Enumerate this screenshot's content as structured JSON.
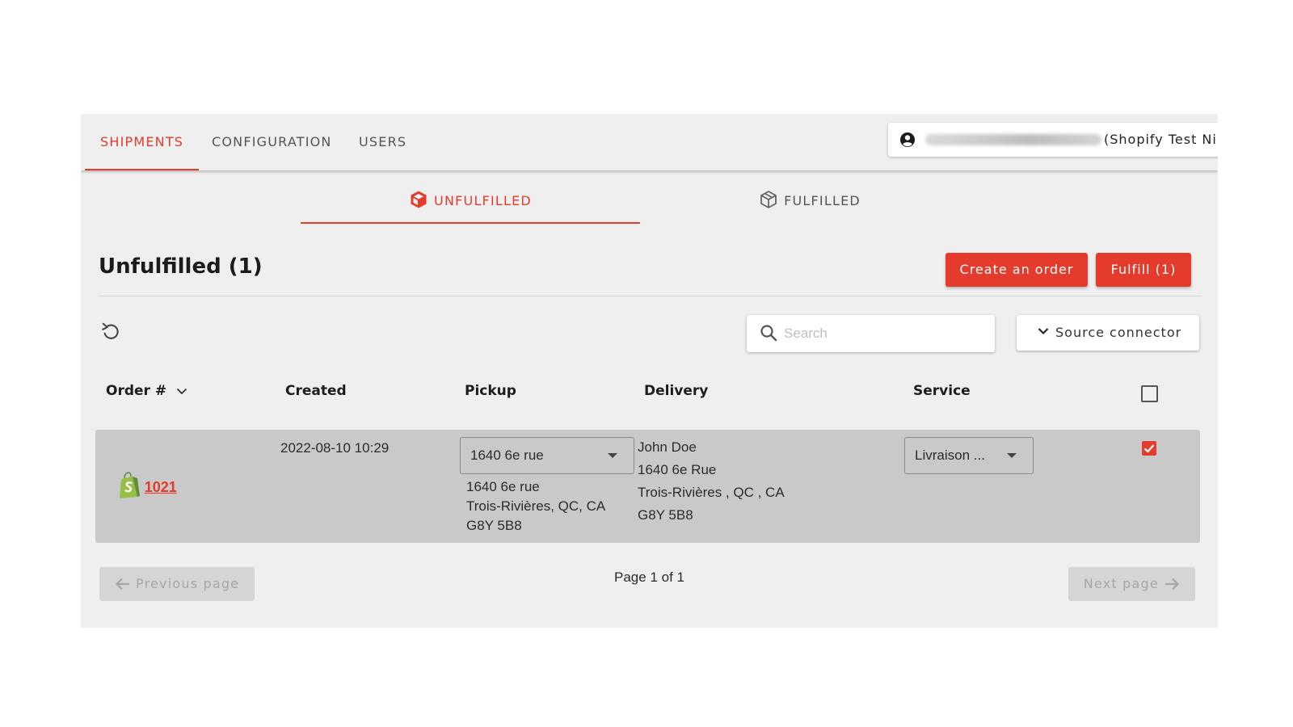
{
  "nav": {
    "tabs": [
      {
        "label": "SHIPMENTS",
        "active": true
      },
      {
        "label": "CONFIGURATION",
        "active": false
      },
      {
        "label": "USERS",
        "active": false
      }
    ],
    "account": {
      "icon": "user-circle-icon",
      "store_label": "(Shopify Test Ni"
    }
  },
  "status_tabs": [
    {
      "label": "UNFULFILLED",
      "icon": "box-icon",
      "active": true
    },
    {
      "label": "FULFILLED",
      "icon": "box-outline-icon",
      "active": false
    }
  ],
  "page_title": "Unfulfilled (1)",
  "actions": {
    "create_order": "Create an order",
    "fulfill": "Fulfill (1)"
  },
  "search": {
    "placeholder": "Search",
    "value": ""
  },
  "source_connector": {
    "label": "Source connector"
  },
  "table": {
    "columns": [
      "Order #",
      "Created",
      "Pickup",
      "Delivery",
      "Service"
    ],
    "rows": [
      {
        "order": "1021",
        "source_icon": "shopify-icon",
        "created": "2022-08-10 10:29",
        "pickup_select": "1640 6e rue",
        "pickup_address": [
          "1640 6e rue",
          "Trois-Rivières, QC, CA",
          "G8Y 5B8"
        ],
        "delivery": [
          "John Doe",
          "1640 6e Rue",
          "Trois-Rivières , QC , CA",
          "G8Y 5B8"
        ],
        "service_select": "Livraison ...",
        "selected": true
      }
    ]
  },
  "pagination": {
    "previous": "Previous page",
    "info": "Page 1 of 1",
    "next": "Next page"
  },
  "colors": {
    "accent": "#e53b2c",
    "row_selected": "#c9c9c9",
    "background": "#efefef"
  }
}
